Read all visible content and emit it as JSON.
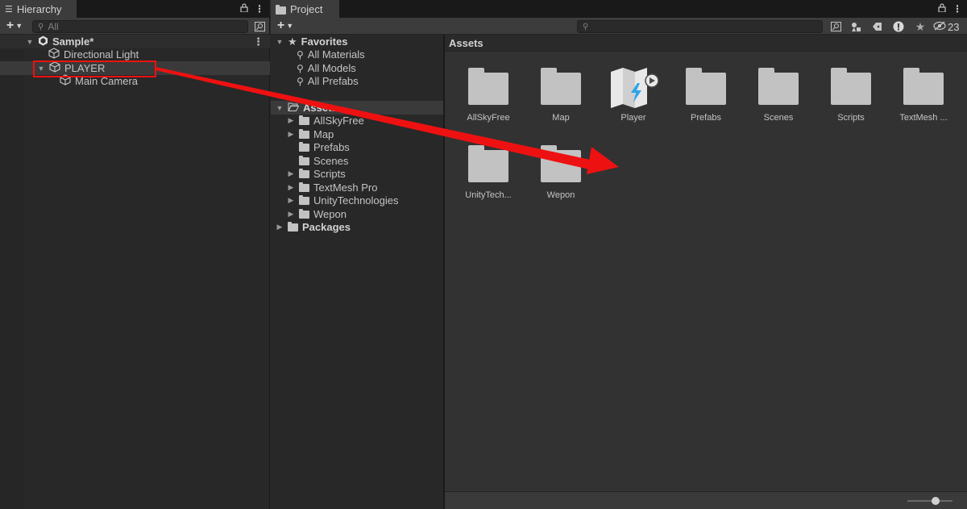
{
  "hierarchy": {
    "tab_label": "Hierarchy",
    "search_placeholder": "All",
    "scene_name": "Sample*",
    "items": [
      {
        "label": "Directional Light"
      },
      {
        "label": "PLAYER"
      },
      {
        "label": "Main Camera"
      }
    ]
  },
  "project": {
    "tab_label": "Project",
    "hidden_count": "23",
    "favorites": {
      "label": "Favorites",
      "items": [
        "All Materials",
        "All Models",
        "All Prefabs"
      ]
    },
    "assets_tree": {
      "label": "Assets",
      "items": [
        "AllSkyFree",
        "Map",
        "Prefabs",
        "Scenes",
        "Scripts",
        "TextMesh Pro",
        "UnityTechnologies",
        "Wepon"
      ]
    },
    "packages_label": "Packages",
    "breadcrumb": "Assets",
    "grid": [
      "AllSkyFree",
      "Map",
      "Player",
      "Prefabs",
      "Scenes",
      "Scripts",
      "TextMesh ...",
      "UnityTech...",
      "Wepon"
    ]
  },
  "colors": {
    "annotation": "#ee1111"
  }
}
